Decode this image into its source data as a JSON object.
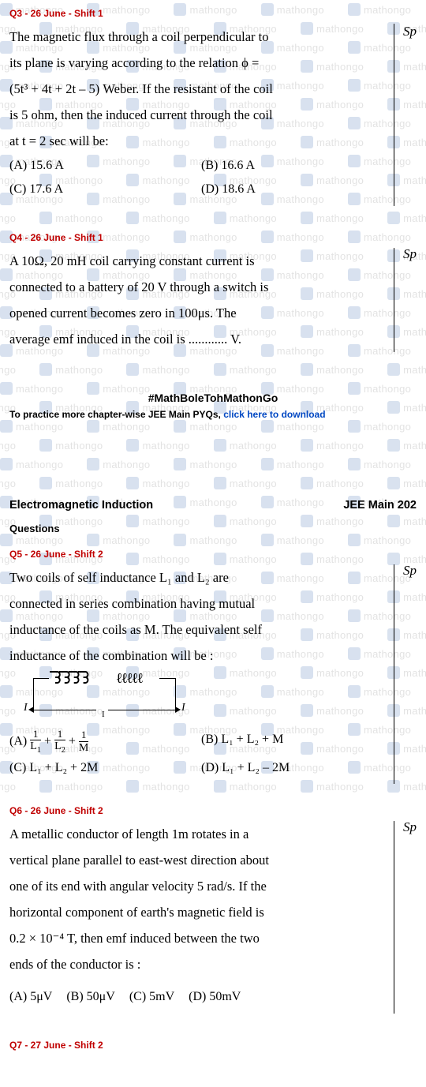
{
  "watermark": "mathongo",
  "q3": {
    "header": "Q3 - 26 June - Shift 1",
    "text_1": "The magnetic flux through a coil perpendicular to",
    "text_2": "its plane is varying according to the relation ϕ =",
    "text_3": "(5t³ + 4t + 2t – 5) Weber. If the resistant of the coil",
    "text_4": "is 5 ohm, then the induced current through the coil",
    "text_5": "at t = 2 sec will be:",
    "optA": "(A) 15.6 A",
    "optB": "(B) 16.6 A",
    "optC": "(C) 17.6 A",
    "optD": "(D) 18.6 A",
    "sp": "Sp"
  },
  "q4": {
    "header": "Q4 - 26 June - Shift 1",
    "text_1": "A 10Ω, 20 mH coil carrying constant current is",
    "text_2": "connected to a battery of 20 V through a switch is",
    "text_3": "opened current becomes zero in 100μs. The",
    "text_4": "average emf induced in the coil is ............ V.",
    "sp": "Sp"
  },
  "hashtag": "#MathBoleTohMathonGo",
  "practice_prefix": "To practice more chapter-wise JEE Main PYQs, ",
  "practice_link": "click here to download",
  "chapter_title": "Electromagnetic Induction",
  "exam_tag": "JEE Main 202",
  "sub_heading": "Questions",
  "q5": {
    "header": "Q5 - 26 June - Shift 2",
    "text_1": "Two coils of self inductance L₁ and L₂ are",
    "text_2": "connected in series combination having mutual",
    "text_3": "inductance of the coils as M. The equivalent self",
    "text_4": "inductance of the combination will be :",
    "optA_prefix": "(A) ",
    "optB": "(B) L₁ + L₂ + M",
    "optC": "(C) L₁ + L₂ + 2M",
    "optD": "(D) L₁ + L₂ – 2M",
    "sp": "Sp",
    "circuit_i": "I"
  },
  "q6": {
    "header": "Q6 - 26 June - Shift 2",
    "text_1": "A metallic conductor of length 1m rotates in a",
    "text_2": "vertical plane parallel to east-west direction about",
    "text_3": "one of its end with angular velocity 5 rad/s. If the",
    "text_4": "horizontal component of earth's magnetic field is",
    "text_5": "0.2 × 10⁻⁴ T, then emf induced between the two",
    "text_6": "ends of the conductor is :",
    "optA": "(A) 5μV",
    "optB": "(B) 50μV",
    "optC": "(C) 5mV",
    "optD": "(D) 50mV",
    "sp": "Sp"
  },
  "q7": {
    "header": "Q7 - 27 June - Shift 2"
  }
}
